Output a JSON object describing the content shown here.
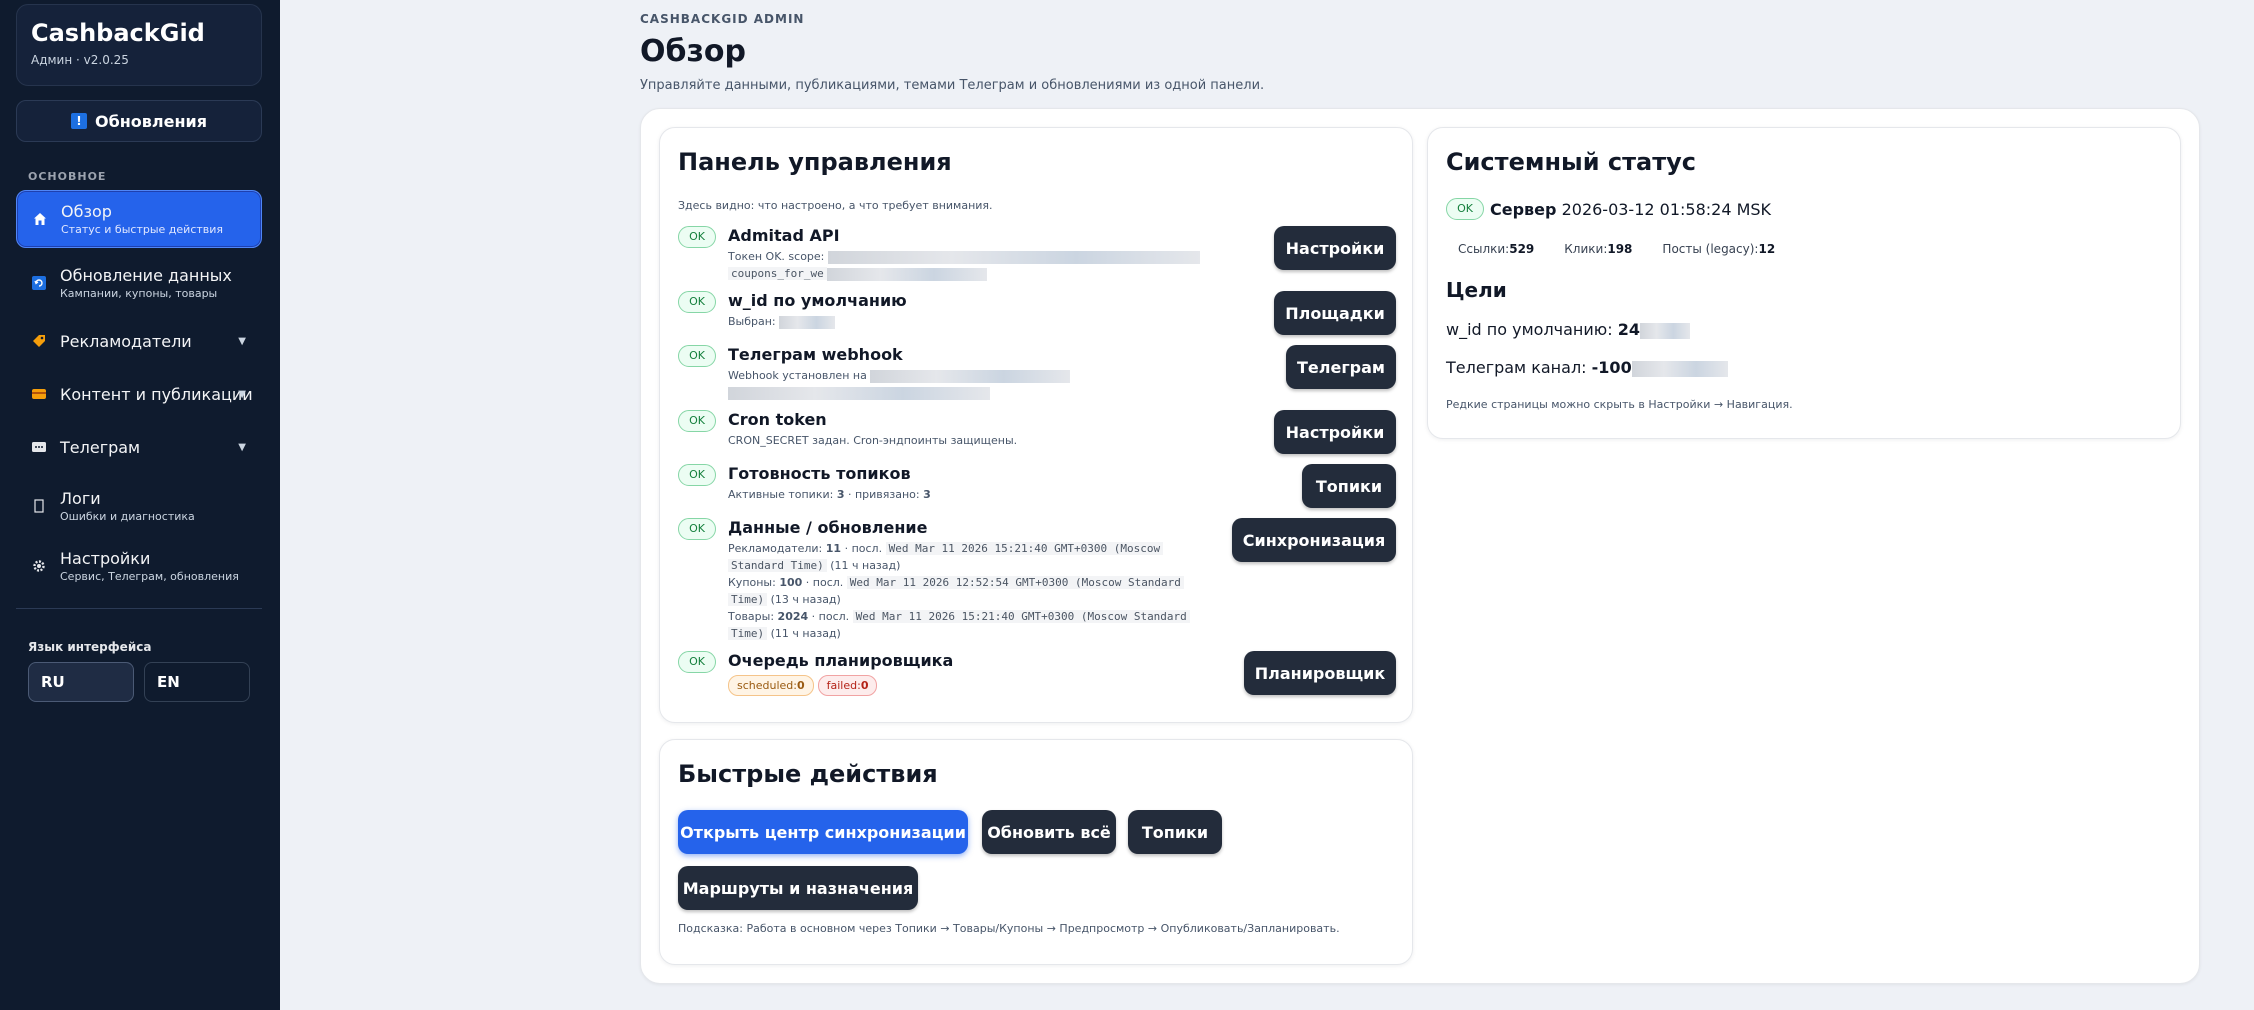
{
  "sidebar": {
    "brand_title": "CashbackGid",
    "brand_sub": "Админ · v2.0.25",
    "updates_icon": "!",
    "updates_label": "Обновления",
    "section_label": "ОСНОВНОЕ",
    "items": [
      {
        "label": "Обзор",
        "sub": "Статус и быстрые действия",
        "icon": "home-icon"
      },
      {
        "label": "Обновление данных",
        "sub": "Кампании, купоны, товары",
        "icon": "refresh-icon"
      },
      {
        "label": "Рекламодатели",
        "sub": "",
        "icon": "tag-icon"
      },
      {
        "label": "Контент и публикации",
        "sub": "",
        "icon": "card-icon"
      },
      {
        "label": "Телеграм",
        "sub": "",
        "icon": "chat-icon"
      },
      {
        "label": "Логи",
        "sub": "Ошибки и диагностика",
        "icon": "log-icon"
      },
      {
        "label": "Настройки",
        "sub": "Сервис, Телеграм, обновления",
        "icon": "gear-icon"
      }
    ],
    "lang_label": "Язык интерфейса",
    "lang_ru": "RU",
    "lang_en": "EN"
  },
  "header": {
    "eyebrow": "CASHBACKGID ADMIN",
    "title": "Обзор",
    "description": "Управляйте данными, публикациями, темами Телеграм и обновлениями из одной панели."
  },
  "control_panel": {
    "title": "Панель управления",
    "hint": "Здесь видно: что настроено, а что требует внимания.",
    "ok_label": "OK",
    "rows": [
      {
        "title": "Admitad API",
        "sub": "Токен OK. scope:",
        "sub_mono": "coupons_for_we",
        "button": "Настройки"
      },
      {
        "title": "w_id по умолчанию",
        "sub": "Выбран:",
        "button": "Площадки"
      },
      {
        "title": "Телеграм webhook",
        "sub": "Webhook установлен на",
        "button": "Телеграм"
      },
      {
        "title": "Cron token",
        "sub": "CRON_SECRET задан. Cron-эндпоинты защищены.",
        "button": "Настройки"
      },
      {
        "title": "Готовность топиков",
        "sub_prefix": "Активные топики:",
        "active": "3",
        "sub_mid": "· привязано:",
        "bound": "3",
        "button": "Топики"
      },
      {
        "title": "Данные / обновление",
        "button": "Синхронизация",
        "lines": [
          {
            "label": "Рекламодатели:",
            "count": "11",
            "last": "· посл.",
            "date1": "Wed Mar 11 2026 15:21:40 GMT+0300 (Moscow",
            "date2": "Standard Time)",
            "ago": "(11 ч назад)"
          },
          {
            "label": "Купоны:",
            "count": "100",
            "last": "· посл.",
            "date1": "Wed Mar 11 2026 12:52:54 GMT+0300 (Moscow Standard",
            "date2": "Time)",
            "ago": "(13 ч назад)"
          },
          {
            "label": "Товары:",
            "count": "2024",
            "last": "· посл.",
            "date1": "Wed Mar 11 2026 15:21:40 GMT+0300 (Moscow Standard",
            "date2": "Time)",
            "ago": "(11 ч назад)"
          }
        ]
      },
      {
        "title": "Очередь планировщика",
        "scheduled_label": "scheduled:",
        "scheduled": "0",
        "failed_label": "failed:",
        "failed": "0",
        "button": "Планировщик"
      }
    ]
  },
  "quick_actions": {
    "title": "Быстрые действия",
    "buttons": [
      "Открыть центр синхронизации",
      "Обновить всё",
      "Топики",
      "Маршруты и назначения"
    ],
    "hint": "Подсказка: Работа в основном через Топики → Товары/Купоны → Предпросмотр → Опубликовать/Запланировать."
  },
  "system_status": {
    "title": "Системный статус",
    "ok_label": "OK",
    "server_label": "Сервер",
    "server_time": "2026-03-12 01:58:24 MSK",
    "links_label": "Ссылки:",
    "links": "529",
    "clicks_label": "Клики:",
    "clicks": "198",
    "posts_label": "Посты (legacy):",
    "posts": "12",
    "goals_title": "Цели",
    "wid_label": "w_id по умолчанию:",
    "wid_value": "24",
    "tg_label": "Телеграм канал:",
    "tg_value": "-100",
    "note": "Редкие страницы можно скрыть в Настройки → Навигация."
  }
}
